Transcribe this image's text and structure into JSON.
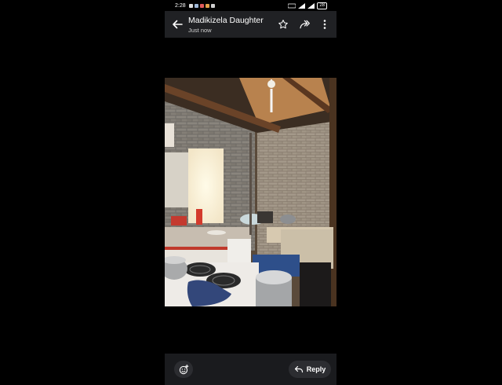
{
  "status_bar": {
    "time": "2:28",
    "battery": "28"
  },
  "header": {
    "sender": "Madikizela Daughter",
    "timestamp": "Just now",
    "icons": [
      "arrow-back-icon",
      "star-icon",
      "forward-icon",
      "more-vert-icon"
    ]
  },
  "photo": {
    "subject": "kitchen"
  },
  "footer": {
    "react_icon": "add-reaction-icon",
    "reply_label": "Reply",
    "reply_icon": "reply-icon"
  },
  "colors": {
    "background": "#000000",
    "appbar": "#202124",
    "bottombar": "#1a1b1e",
    "pill": "#2c2d31"
  }
}
